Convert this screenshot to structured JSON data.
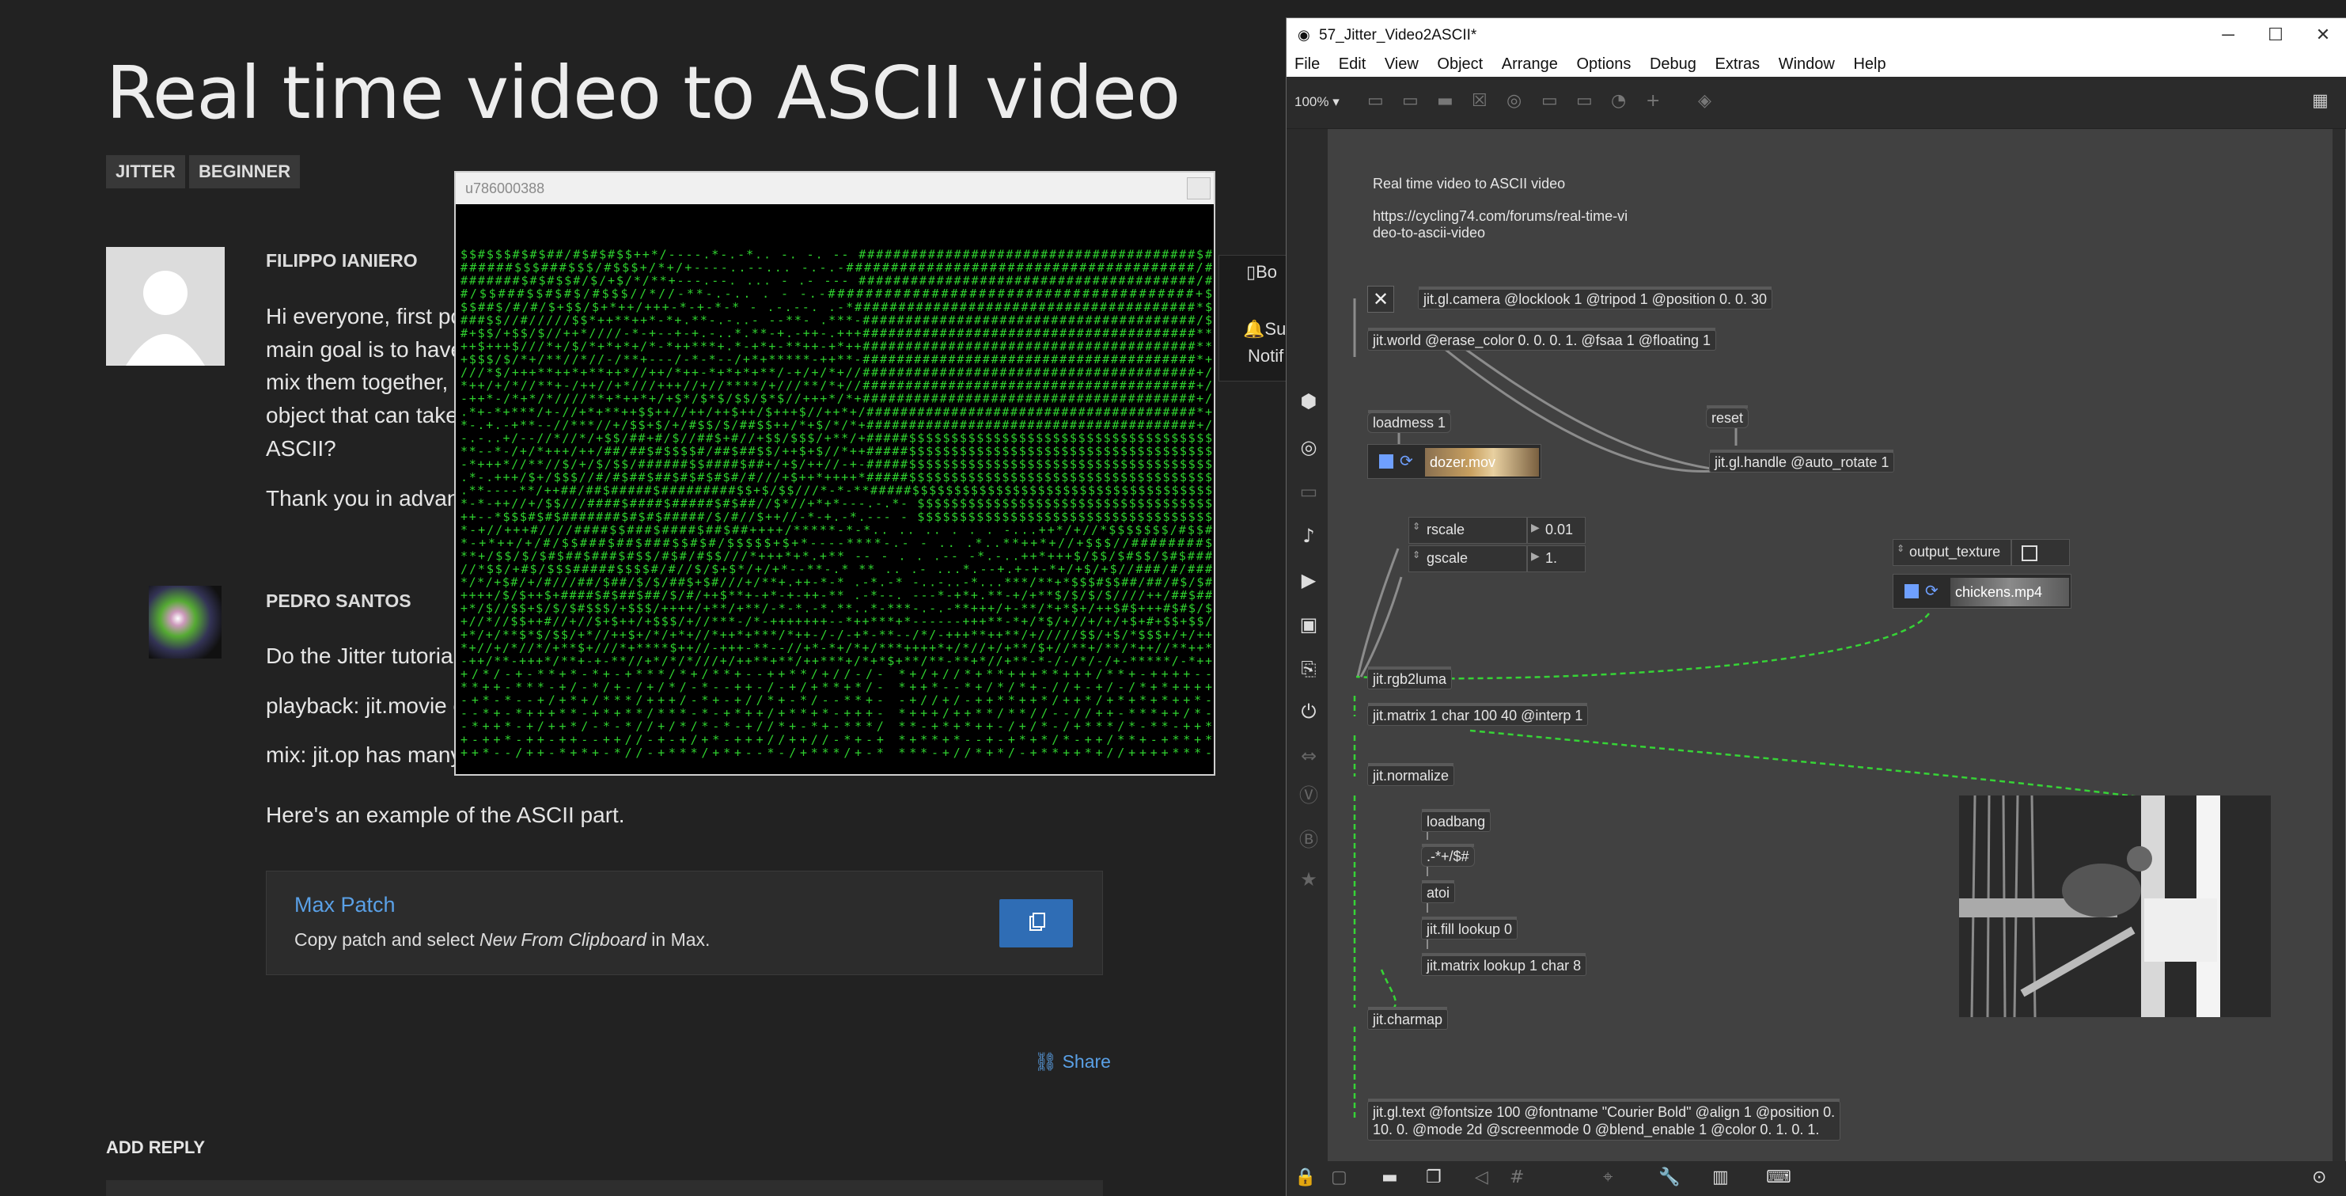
{
  "forum": {
    "title": "Real time video to ASCII video",
    "tags": [
      "JITTER",
      "BEGINNER"
    ],
    "post1": {
      "author": "FILIPPO IANIERO",
      "lines": [
        "Hi everyone, first po",
        "main goal is to have a",
        "mix them together, th",
        "object that can take",
        "ASCII?"
      ],
      "thanks": "Thank you in advanc"
    },
    "partial_right": {
      "bookmark": "Bo",
      "subscribe": "Subscr",
      "notify": "Notif"
    },
    "post2": {
      "author": "PEDRO SANTOS",
      "lines": [
        "Do the Jitter tutorial",
        "playback: jit.movie o",
        "mix: jit.op has many c"
      ],
      "example": "Here's an example of the ASCII part."
    },
    "max_patch": {
      "title": "Max Patch",
      "desc_pre": "Copy patch and select ",
      "desc_em": "New From Clipboard",
      "desc_post": " in Max."
    },
    "share": "Share",
    "add_reply": "ADD REPLY"
  },
  "ascii_window": {
    "title": "u786000388"
  },
  "max_window": {
    "title": "57_Jitter_Video2ASCII*",
    "menu": [
      "File",
      "Edit",
      "View",
      "Object",
      "Arrange",
      "Options",
      "Debug",
      "Extras",
      "Window",
      "Help"
    ],
    "zoom": "100%",
    "comment": "Real time video to ASCII video",
    "url_line1": "https://cycling74.com/forums/real-time-vi",
    "url_line2": "deo-to-ascii-video",
    "objects": {
      "camera": "jit.gl.camera @locklook 1 @tripod 1 @position 0. 0. 30",
      "world": "jit.world @erase_color 0. 0. 0. 1. @fsaa 1 @floating 1",
      "loadmess": "loadmess 1",
      "reset": "reset",
      "handle": "jit.gl.handle @auto_rotate 1",
      "movie1": "dozer.mov",
      "rscale": "rscale",
      "gscale": "gscale",
      "rscale_val": "0.01",
      "gscale_val": "1.",
      "output_texture": "output_texture",
      "movie2": "chickens.mp4",
      "rgb2luma": "jit.rgb2luma",
      "matrix": "jit.matrix 1 char 100 40 @interp 1",
      "normalize": "jit.normalize",
      "loadbang": "loadbang",
      "chars": " .-*+/$#",
      "atoi": "atoi",
      "fill": "jit.fill lookup 0",
      "matrix2": "jit.matrix lookup 1 char 8",
      "charmap": "jit.charmap",
      "text_line1": "jit.gl.text @fontsize 100 @fontname \"Courier Bold\" @align 1 @position 0.",
      "text_line2": "10. 0. @mode 2d @screenmode 0 @blend_enable 1 @color 0. 1. 0. 1."
    }
  },
  "colors": {
    "ascii_green": "#2fd22f",
    "link_blue": "#5aa0e6",
    "patch_cord_green": "#36d436"
  }
}
